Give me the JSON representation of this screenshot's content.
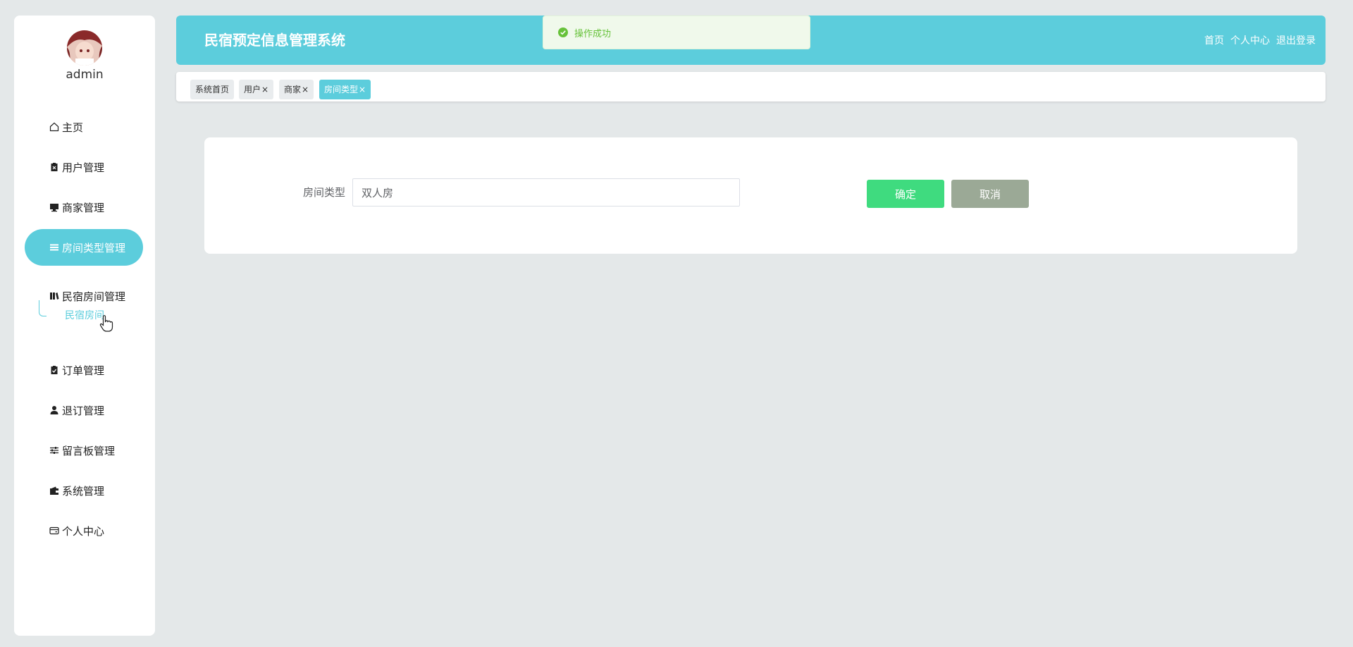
{
  "app": {
    "title": "民宿预定信息管理系统"
  },
  "user": {
    "name": "admin"
  },
  "header": {
    "links": [
      "首页",
      "个人中心",
      "退出登录"
    ]
  },
  "toast": {
    "message": "操作成功",
    "color": "#67c23a"
  },
  "sidebar": {
    "items": [
      {
        "label": "主页",
        "icon": "home-icon"
      },
      {
        "label": "用户管理",
        "icon": "user-mgmt-icon"
      },
      {
        "label": "商家管理",
        "icon": "monitor-icon"
      },
      {
        "label": "房间类型管理",
        "icon": "list-icon",
        "active": true
      },
      {
        "label": "民宿房间管理",
        "icon": "books-icon"
      },
      {
        "label": "订单管理",
        "icon": "clipboard-check-icon"
      },
      {
        "label": "退订管理",
        "icon": "person-icon"
      },
      {
        "label": "留言板管理",
        "icon": "sliders-icon"
      },
      {
        "label": "系统管理",
        "icon": "wallet-icon"
      },
      {
        "label": "个人中心",
        "icon": "card-icon"
      }
    ],
    "sub_item": "民宿房间"
  },
  "tabs": [
    {
      "label": "系统首页",
      "closable": false
    },
    {
      "label": "用户",
      "closable": true
    },
    {
      "label": "商家",
      "closable": true
    },
    {
      "label": "房间类型",
      "closable": true,
      "active": true
    }
  ],
  "form": {
    "room_type_label": "房间类型",
    "room_type_value": "双人房",
    "confirm_label": "确定",
    "cancel_label": "取消"
  },
  "colors": {
    "accent": "#5ccddc",
    "confirm": "#3fdb7f",
    "cancel": "#9ba996",
    "background": "#e4e8e9"
  }
}
